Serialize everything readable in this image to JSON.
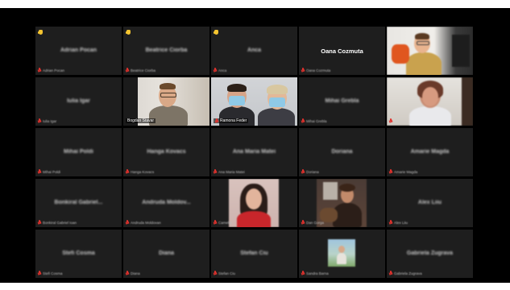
{
  "colors": {
    "background": "#000000",
    "tile": "#1e1e1e",
    "active_speaker_border": "#9ed15a",
    "muted_mic": "#e0322d",
    "raised_hand": "#f4c430"
  },
  "participants": [
    {
      "name": "Adrian Pocan",
      "footer": "Adrian Pocan",
      "muted": true,
      "raised_hand": true
    },
    {
      "name": "Beatrice Ciorba",
      "footer": "Beatrice Ciorba",
      "muted": true,
      "raised_hand": true
    },
    {
      "name": "Anca",
      "footer": "Anca",
      "muted": true,
      "raised_hand": true
    },
    {
      "name": "Oana Cozmuta",
      "footer": "Oana Cozmuta",
      "muted": true
    },
    {
      "name": "",
      "footer": "",
      "video": true
    },
    {
      "name": "Iulia Igar",
      "footer": "Iulia Igar",
      "muted": true
    },
    {
      "name": "",
      "footer": "Bogdan Stavar",
      "video": true,
      "active": true,
      "muted": true
    },
    {
      "name": "",
      "footer": "Ramona Feder",
      "video": true,
      "muted": true
    },
    {
      "name": "Mihai Grebla",
      "footer": "Mihai Grebla",
      "muted": true
    },
    {
      "name": "",
      "footer": "",
      "video": true
    },
    {
      "name": "Mihai Poldi",
      "footer": "Mihai Poldi",
      "muted": true
    },
    {
      "name": "Hanga Kovacs",
      "footer": "Hanga Kovacs",
      "muted": true
    },
    {
      "name": "Ana Maria Matei",
      "footer": "Ana Maria Matei",
      "muted": true
    },
    {
      "name": "Doriana",
      "footer": "Doriana",
      "muted": true
    },
    {
      "name": "Amarie Magda",
      "footer": "Amarie Magda",
      "muted": true
    },
    {
      "name": "Bonkiral Gabriel...",
      "footer": "Bonkiral Gabriel Ioan",
      "muted": true
    },
    {
      "name": "Andruda Moldov...",
      "footer": "Andruda Moldovan",
      "muted": true
    },
    {
      "name": "",
      "footer": "Camelia",
      "video": true,
      "muted": true
    },
    {
      "name": "",
      "footer": "Dan Gorga",
      "video": true,
      "muted": true
    },
    {
      "name": "Alex Liiu",
      "footer": "Alex Liiu",
      "muted": true
    },
    {
      "name": "Stefi Cosma",
      "footer": "Stefi Cosma",
      "muted": true
    },
    {
      "name": "Diana",
      "footer": "Diana",
      "muted": true
    },
    {
      "name": "Stefan Ciu",
      "footer": "Stefan Ciu",
      "muted": true
    },
    {
      "name": "",
      "footer": "Sandra Barna",
      "video": true,
      "muted": true
    },
    {
      "name": "Gabriela Zugrava",
      "footer": "Gabriela Zugrava",
      "muted": true
    }
  ]
}
